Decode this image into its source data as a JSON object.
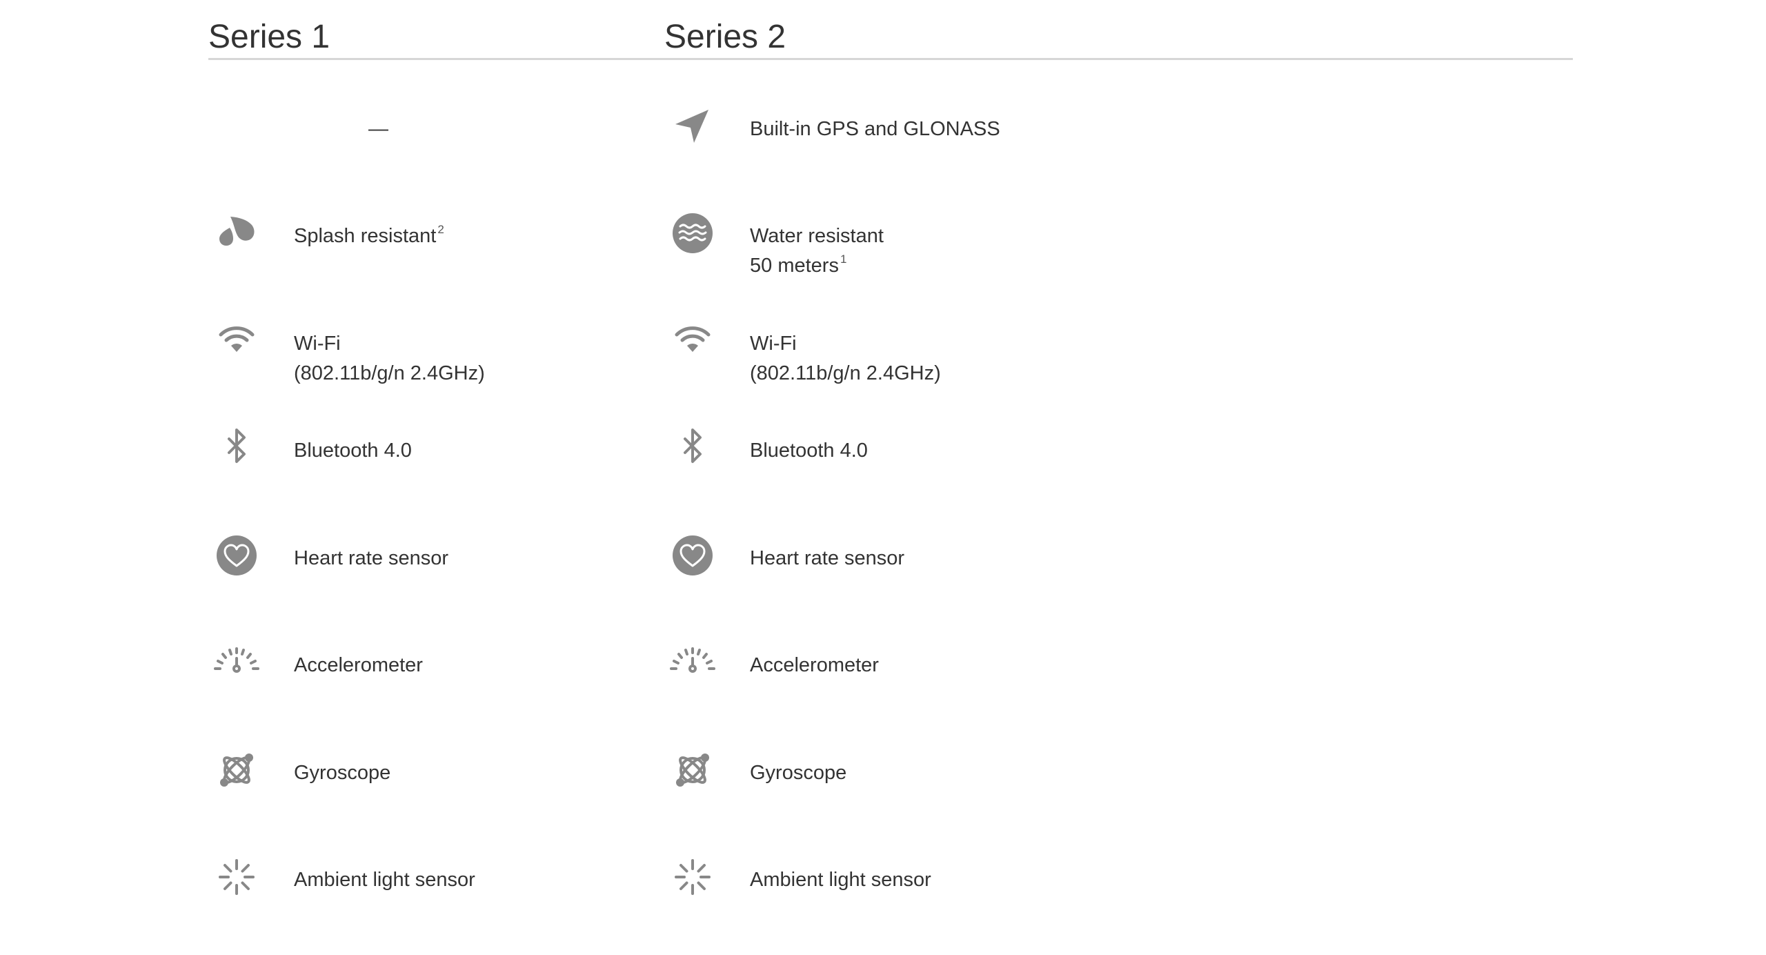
{
  "columns": [
    {
      "title": "Series 1"
    },
    {
      "title": "Series 2"
    }
  ],
  "rows": [
    {
      "s1": {
        "icon": "none",
        "dash": "—"
      },
      "s2": {
        "icon": "location-arrow-icon",
        "line1": "Built-in GPS and GLONASS"
      }
    },
    {
      "s1": {
        "icon": "splash-drops-icon",
        "line1": "Splash resistant",
        "sup": "2"
      },
      "s2": {
        "icon": "water-waves-icon",
        "line1": "Water resistant",
        "line2": "50 meters",
        "sup": "1"
      }
    },
    {
      "s1": {
        "icon": "wifi-icon",
        "line1": "Wi-Fi",
        "line2": "(802.11b/g/n 2.4GHz)"
      },
      "s2": {
        "icon": "wifi-icon",
        "line1": "Wi-Fi",
        "line2": "(802.11b/g/n 2.4GHz)"
      }
    },
    {
      "s1": {
        "icon": "bluetooth-icon",
        "line1": "Bluetooth 4.0"
      },
      "s2": {
        "icon": "bluetooth-icon",
        "line1": "Bluetooth 4.0"
      }
    },
    {
      "s1": {
        "icon": "heart-rate-icon",
        "line1": "Heart rate sensor"
      },
      "s2": {
        "icon": "heart-rate-icon",
        "line1": "Heart rate sensor"
      }
    },
    {
      "s1": {
        "icon": "accelerometer-gauge-icon",
        "line1": "Accelerometer"
      },
      "s2": {
        "icon": "accelerometer-gauge-icon",
        "line1": "Accelerometer"
      }
    },
    {
      "s1": {
        "icon": "gyroscope-icon",
        "line1": "Gyroscope"
      },
      "s2": {
        "icon": "gyroscope-icon",
        "line1": "Gyroscope"
      }
    },
    {
      "s1": {
        "icon": "ambient-light-icon",
        "line1": "Ambient light sensor"
      },
      "s2": {
        "icon": "ambient-light-icon",
        "line1": "Ambient light sensor"
      }
    }
  ],
  "colors": {
    "text": "#333333",
    "icon": "#888888",
    "divider": "#d6d6d6"
  }
}
